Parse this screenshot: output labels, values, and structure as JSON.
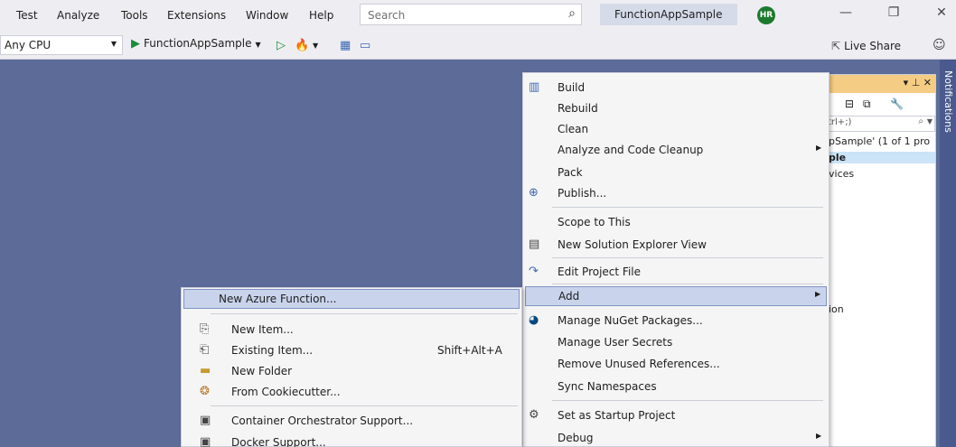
{
  "menubar": {
    "items": [
      "Test",
      "Analyze",
      "Tools",
      "Extensions",
      "Window",
      "Help"
    ],
    "search_placeholder": "Search",
    "solution_name": "FunctionAppSample",
    "avatar_initials": "HR"
  },
  "toolbar": {
    "platform": "Any CPU",
    "run_target": "FunctionAppSample",
    "live_share": "Live Share"
  },
  "solution_explorer": {
    "search_text": "trl+;)",
    "row_1": "pSample' (1 of 1 pro",
    "row_2": "ple",
    "row_3": "vices",
    "row_4": "ion"
  },
  "notifications_label": "Notifications",
  "project_menu": {
    "items": [
      {
        "label": "Build",
        "icon": "build-icon"
      },
      {
        "label": "Rebuild"
      },
      {
        "label": "Clean"
      },
      {
        "label": "Analyze and Code Cleanup",
        "submenu": true
      },
      {
        "label": "Pack"
      },
      {
        "label": "Publish...",
        "icon": "publish-globe-icon"
      },
      {
        "label": "Scope to This"
      },
      {
        "label": "New Solution Explorer View",
        "icon": "new-view-icon"
      },
      {
        "label": "Edit Project File",
        "icon": "edit-arrow-icon"
      },
      {
        "label": "Add",
        "submenu": true,
        "highlighted": true
      },
      {
        "label": "Manage NuGet Packages...",
        "icon": "nuget-icon"
      },
      {
        "label": "Manage User Secrets"
      },
      {
        "label": "Remove Unused References..."
      },
      {
        "label": "Sync Namespaces"
      },
      {
        "label": "Set as Startup Project",
        "icon": "gear-icon"
      },
      {
        "label": "Debug",
        "submenu": true
      }
    ]
  },
  "add_menu": {
    "items": [
      {
        "label": "New Azure Function...",
        "highlighted": true
      },
      {
        "label": "New Item...",
        "icon": "new-item-icon"
      },
      {
        "label": "Existing Item...",
        "icon": "existing-item-icon",
        "shortcut": "Shift+Alt+A"
      },
      {
        "label": "New Folder",
        "icon": "folder-icon"
      },
      {
        "label": "From Cookiecutter...",
        "icon": "cookiecutter-icon"
      },
      {
        "label": "Container Orchestrator Support...",
        "icon": "orchestrator-icon"
      },
      {
        "label": "Docker Support...",
        "icon": "docker-icon"
      }
    ]
  },
  "colors": {
    "background": "#5d6b99",
    "menu_highlight": "#c9d4ec",
    "solution_name_bg": "#d6dbe9"
  }
}
